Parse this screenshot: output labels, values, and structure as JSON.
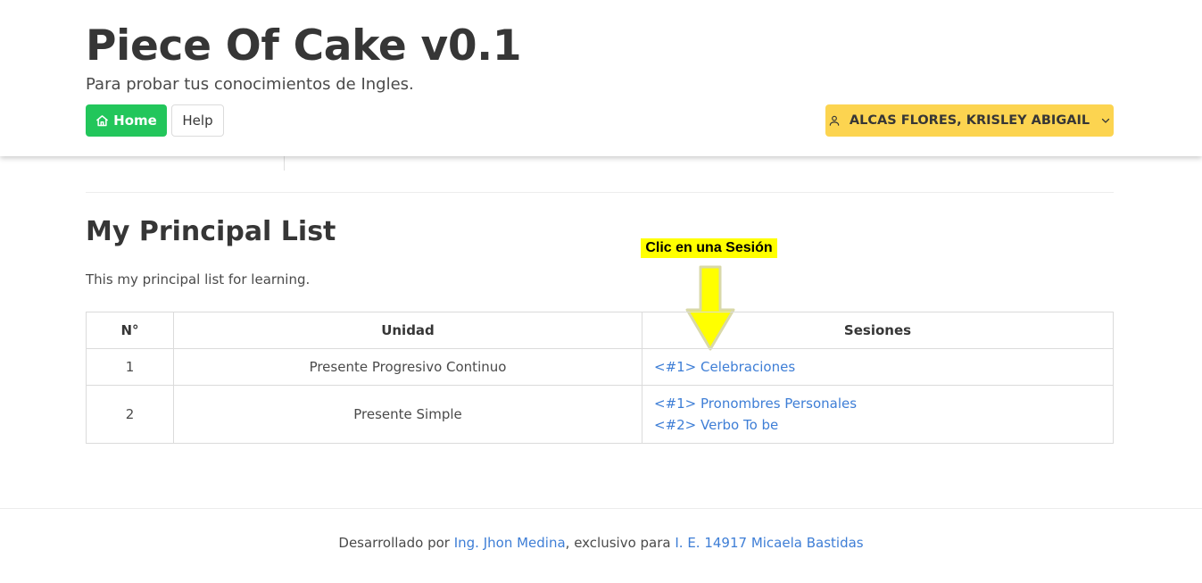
{
  "header": {
    "title": "Piece Of Cake v0.1",
    "subtitle": "Para probar tus conocimientos de Ingles.",
    "home_label": "Home",
    "help_label": "Help",
    "user_name": "ALCAS FLORES, KRISLEY ABIGAIL"
  },
  "main": {
    "title": "My Principal List",
    "description": "This my principal list for learning.",
    "hint": "Clic en una Sesión",
    "table": {
      "headers": [
        "N°",
        "Unidad",
        "Sesiones"
      ],
      "rows": [
        {
          "num": "1",
          "unit": "Presente Progresivo Continuo",
          "sessions": [
            "<#1> Celebraciones"
          ]
        },
        {
          "num": "2",
          "unit": "Presente Simple",
          "sessions": [
            "<#1> Pronombres Personales",
            "<#2> Verbo To be"
          ]
        }
      ]
    }
  },
  "footer": {
    "prefix": "Desarrollado por ",
    "author": "Ing. Jhon Medina",
    "middle": ", exclusivo para ",
    "institution": "I. E. 14917 Micaela Bastidas"
  },
  "colors": {
    "primary_green": "#22c65b",
    "warning_yellow": "#fcd450",
    "link_blue": "#3e7ed6",
    "hint_yellow": "#ffff00"
  },
  "icons": {
    "home": "home-icon",
    "user": "user-icon",
    "chevron": "chevron-down-icon",
    "arrow": "arrow-down-icon"
  }
}
